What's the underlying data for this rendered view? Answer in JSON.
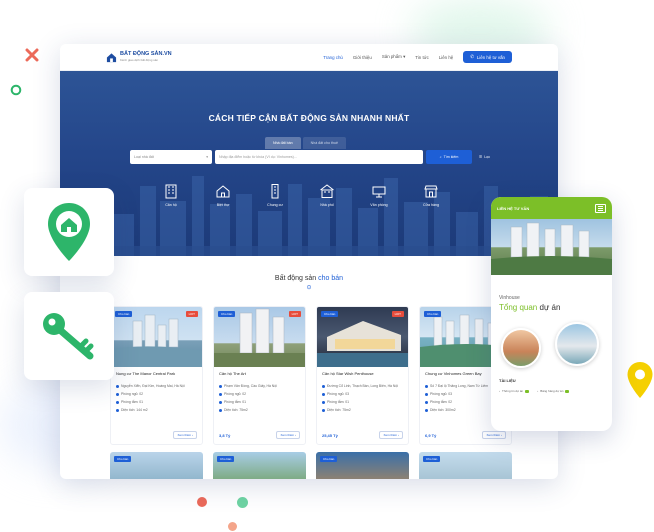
{
  "brand": {
    "name": "BẤT ĐỘNG SẢN.VN",
    "tagline": "Kênh giao dịch bất động sản"
  },
  "nav": {
    "items": [
      "Trang chủ",
      "Giới thiệu",
      "Sản phẩm",
      "Tin tức",
      "Liên hệ"
    ],
    "cta": "Liên hệ tư vấn"
  },
  "hero": {
    "title": "CÁCH TIẾP CẬN BẤT ĐỘNG SẢN NHANH NHẤT",
    "tabs": [
      "Nhà đất bán",
      "Nhà đất cho thuê"
    ],
    "type_select": "Loại nhà đất",
    "search_placeholder": "Nhập địa điểm hoặc từ khóa (VI dụ: Vinhomes)...",
    "search_button": "Tìm kiếm",
    "filter_label": "Lọc",
    "categories": [
      "Căn hộ",
      "Biệt thự",
      "Chung cư",
      "Nhà phố",
      "Văn phòng",
      "Cửa hàng"
    ]
  },
  "section": {
    "title_prefix": "Bất động sản",
    "title_highlight": "cho bán"
  },
  "cards": [
    {
      "badge": "Cho bán",
      "hot": "HOT",
      "name": "Nung cư The Manor Central Park",
      "address": "Nguyễn Xiển, Đại Kim, Hoàng Mai, Hà Nội",
      "bedrooms": "Phòng ngủ: 02",
      "bathrooms": "Phòng tắm: 01",
      "area": "Diện tích: 144 m2",
      "price": "",
      "more": "Xem thêm"
    },
    {
      "badge": "Cho bán",
      "hot": "HOT",
      "name": "Căn hộ The Art",
      "address": "Phạm Văn Đồng, Cầu Giấy, Hà Nội",
      "bedrooms": "Phòng ngủ: 02",
      "bathrooms": "Phòng tắm: 01",
      "area": "Diện tích: 75m2",
      "price": "3,8 Tỷ",
      "more": "Xem thêm"
    },
    {
      "badge": "Cho bán",
      "hot": "HOT",
      "name": "Căn hộ Star Wish Penthouse",
      "address": "Đường Cổ Linh, Thạch Bàn, Long Biên, Hà Nội",
      "bedrooms": "Phòng ngủ: 03",
      "bathrooms": "Phòng tắm: 01",
      "area": "Diện tích: 75m2",
      "price": "25,45 Tỷ",
      "more": "Xem thêm"
    },
    {
      "badge": "Cho bán",
      "hot": "HOT",
      "name": "Chung cư Vinhomes Green Bay",
      "address": "Số 7 Đại lộ Thăng Long, Nam Từ Liêm",
      "bedrooms": "Phòng ngủ: 03",
      "bathrooms": "Phòng tắm: 02",
      "area": "Diện tích: 300m2",
      "price": "6,9 Tỷ",
      "more": "Xem thêm"
    }
  ],
  "row2_badges": [
    "Cho bán",
    "Cho bán",
    "Cho bán",
    "Cho bán"
  ],
  "mobile": {
    "link": "LIÊN HỆ TƯ VẤN",
    "project": "Vinhouse",
    "title_highlight": "Tổng quan",
    "title_rest": " dự án",
    "docs": "TÀI LIỆU",
    "doc_links": [
      "Thông tin dự án",
      "Bảng hàng dự án"
    ]
  },
  "colors": {
    "primary": "#1e5fd6",
    "accent_green": "#7cbf28",
    "pin_green": "#2db56a",
    "pin_yellow": "#f5d000",
    "coral": "#ec6a5a"
  }
}
